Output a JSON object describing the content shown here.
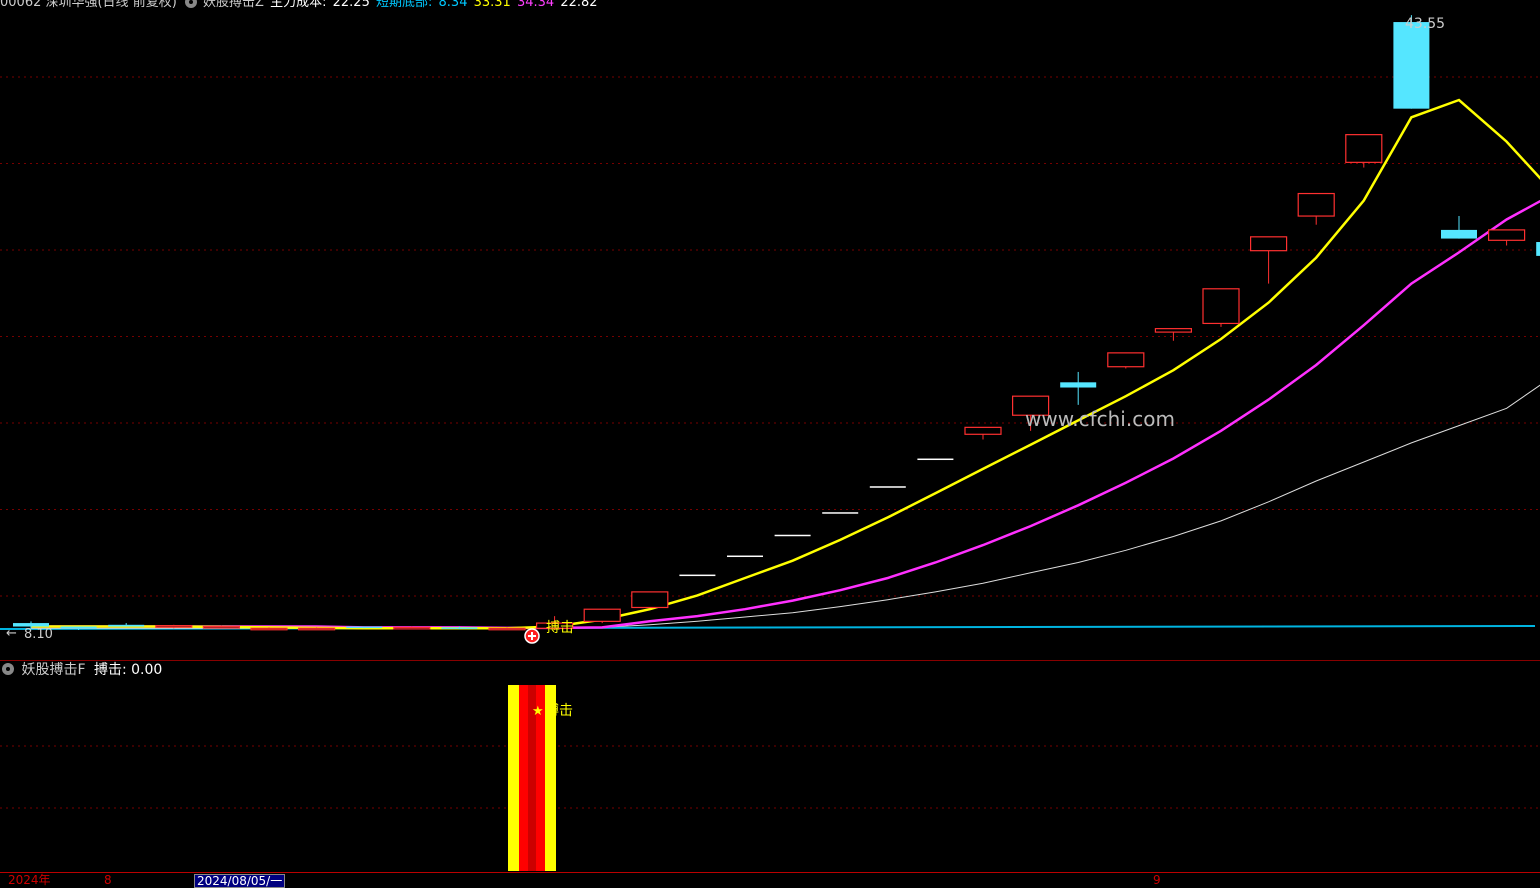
{
  "header": {
    "stock_code_name": "00062 深圳华强(日线 前复权)",
    "indicator_name": "妖股搏击Z",
    "main_cost_label": "主力成本:",
    "main_cost_value": "22.25",
    "short_bottom_label": "短期底部:",
    "short_bottom_value": "8.34",
    "value_yellow": "33.31",
    "value_magenta": "34.34",
    "value_white": "22.82",
    "colors": {
      "cyan": "#00c8ff",
      "yellow": "#ffff00",
      "magenta": "#ff40ff",
      "white": "#ffffff"
    }
  },
  "price_panel": {
    "max_price_label": "43.55",
    "min_price_label": "8.10",
    "min_arrow": "←",
    "signal_label": "搏击",
    "watermark": "www.cfchi.com",
    "candles": [
      {
        "o": 8.5,
        "c": 8.3,
        "h": 8.6,
        "l": 8.2
      },
      {
        "o": 8.3,
        "c": 8.2,
        "h": 8.3,
        "l": 8.1
      },
      {
        "o": 8.4,
        "c": 8.3,
        "h": 8.5,
        "l": 8.3
      },
      {
        "o": 8.3,
        "c": 8.35,
        "h": 8.4,
        "l": 8.2
      },
      {
        "o": 8.25,
        "c": 8.3,
        "h": 8.35,
        "l": 8.2
      },
      {
        "o": 8.2,
        "c": 8.2,
        "h": 8.25,
        "l": 8.1
      },
      {
        "o": 8.2,
        "c": 8.2,
        "h": 8.25,
        "l": 8.15
      },
      {
        "o": 8.3,
        "c": 8.25,
        "h": 8.3,
        "l": 8.2
      },
      {
        "o": 8.2,
        "c": 8.25,
        "h": 8.3,
        "l": 8.2
      },
      {
        "o": 8.25,
        "c": 8.2,
        "h": 8.3,
        "l": 8.15
      },
      {
        "o": 8.2,
        "c": 8.2,
        "h": 8.25,
        "l": 8.15
      },
      {
        "o": 8.2,
        "c": 8.5,
        "h": 8.9,
        "l": 8.1
      },
      {
        "o": 8.6,
        "c": 9.3,
        "h": 9.3,
        "l": 8.5
      },
      {
        "o": 9.4,
        "c": 10.3,
        "h": 10.3,
        "l": 9.4
      },
      {
        "o": 11.3,
        "c": 11.3,
        "h": 11.3,
        "l": 11.3
      },
      {
        "o": 12.4,
        "c": 12.4,
        "h": 12.4,
        "l": 12.4
      },
      {
        "o": 13.6,
        "c": 13.6,
        "h": 13.6,
        "l": 13.6
      },
      {
        "o": 14.9,
        "c": 14.9,
        "h": 14.9,
        "l": 14.9
      },
      {
        "o": 16.4,
        "c": 16.4,
        "h": 16.4,
        "l": 16.4
      },
      {
        "o": 18.0,
        "c": 18.0,
        "h": 18.0,
        "l": 18.0
      },
      {
        "o": 19.4,
        "c": 19.8,
        "h": 19.8,
        "l": 19.1
      },
      {
        "o": 20.5,
        "c": 21.6,
        "h": 21.6,
        "l": 19.6
      },
      {
        "o": 22.4,
        "c": 22.1,
        "h": 23.0,
        "l": 21.1
      },
      {
        "o": 23.3,
        "c": 24.1,
        "h": 24.1,
        "l": 23.2
      },
      {
        "o": 25.3,
        "c": 25.5,
        "h": 25.5,
        "l": 24.8
      },
      {
        "o": 25.8,
        "c": 27.8,
        "h": 27.8,
        "l": 25.6
      },
      {
        "o": 30.0,
        "c": 30.8,
        "h": 30.8,
        "l": 28.1
      },
      {
        "o": 32.0,
        "c": 33.3,
        "h": 33.3,
        "l": 31.5
      },
      {
        "o": 35.1,
        "c": 36.7,
        "h": 36.7,
        "l": 34.8
      },
      {
        "o": 43.2,
        "c": 38.2,
        "h": 43.6,
        "l": 38.2
      },
      {
        "o": 31.2,
        "c": 30.7,
        "h": 32.0,
        "l": 30.7
      },
      {
        "o": 30.6,
        "c": 31.2,
        "h": 31.2,
        "l": 30.3
      },
      {
        "o": 30.5,
        "c": 29.7,
        "h": 30.6,
        "l": 29.4
      }
    ],
    "ma_short": [
      8.3,
      8.3,
      8.3,
      8.3,
      8.28,
      8.25,
      8.22,
      8.2,
      8.2,
      8.2,
      8.2,
      8.3,
      8.7,
      9.3,
      10.1,
      11.1,
      12.1,
      13.3,
      14.6,
      16.0,
      17.4,
      18.8,
      20.2,
      21.6,
      23.1,
      24.9,
      27.0,
      29.6,
      32.9,
      37.7,
      38.7,
      36.3,
      33.3
    ],
    "ma_mid": [
      8.3,
      8.3,
      8.3,
      8.3,
      8.3,
      8.3,
      8.3,
      8.25,
      8.25,
      8.25,
      8.22,
      8.22,
      8.25,
      8.6,
      8.9,
      9.3,
      9.8,
      10.4,
      11.1,
      12.0,
      13.0,
      14.1,
      15.3,
      16.6,
      18.0,
      19.6,
      21.4,
      23.4,
      25.7,
      28.1,
      29.9,
      31.8,
      33.3
    ],
    "ma_long": [
      8.2,
      8.2,
      8.2,
      8.2,
      8.2,
      8.2,
      8.2,
      8.2,
      8.2,
      8.2,
      8.2,
      8.22,
      8.25,
      8.4,
      8.6,
      8.85,
      9.1,
      9.45,
      9.85,
      10.3,
      10.8,
      11.4,
      12.0,
      12.7,
      13.5,
      14.4,
      15.5,
      16.7,
      17.8,
      18.9,
      19.9,
      20.9,
      22.8
    ],
    "blue_line": 8.1
  },
  "sub_panel": {
    "title": "妖股搏击F",
    "value_label": "搏击:",
    "value": "0.00",
    "signal_label": "搏击",
    "signal_star": "★"
  },
  "time_axis": {
    "year_label": "2024年",
    "month_label_1": "8",
    "date_box": "2024/08/05/一",
    "month_label_2": "9"
  }
}
